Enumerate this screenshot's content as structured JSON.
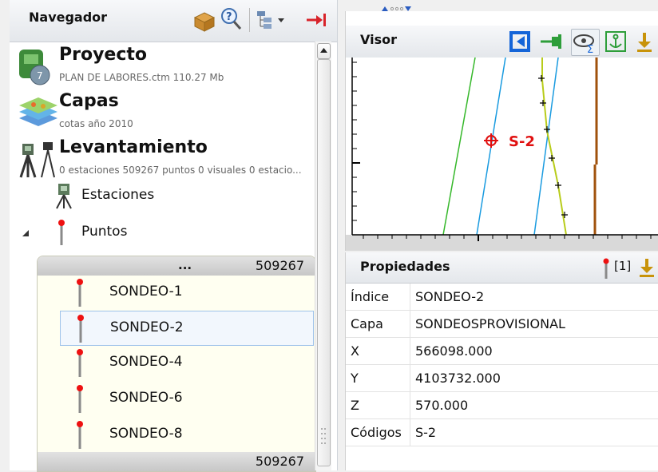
{
  "navigator": {
    "title": "Navegador",
    "groups": [
      {
        "title": "Proyecto",
        "subtitle": "PLAN DE LABORES.ctm 110.27 Mb",
        "icon": "project-icon"
      },
      {
        "title": "Capas",
        "subtitle": "cotas año 2010",
        "icon": "layers-icon"
      },
      {
        "title": "Levantamiento",
        "subtitle": "0 estaciones 509267 puntos 0 visuales 0 estacio...",
        "icon": "survey-icon"
      }
    ],
    "tree": [
      {
        "label": "Estaciones",
        "icon": "station-icon"
      },
      {
        "label": "Puntos",
        "icon": "point-marker-icon",
        "expanded": true
      }
    ],
    "points_list": {
      "header_dots": "...",
      "header_count": "509267",
      "footer_count": "509267",
      "items": [
        "SONDEO-1",
        "SONDEO-2",
        "SONDEO-4",
        "SONDEO-6",
        "SONDEO-8"
      ],
      "selected": "SONDEO-2"
    }
  },
  "visor": {
    "title": "Visor",
    "marker_label": "S-2"
  },
  "properties": {
    "title": "Propiedades",
    "selection_count": "[1]",
    "rows": [
      {
        "key": "Índice",
        "value": "SONDEO-2"
      },
      {
        "key": "Capa",
        "value": "SONDEOSPROVISIONAL"
      },
      {
        "key": "X",
        "value": "566098.000"
      },
      {
        "key": "Y",
        "value": "4103732.000"
      },
      {
        "key": "Z",
        "value": "570.000"
      },
      {
        "key": "Códigos",
        "value": "S-2"
      }
    ]
  },
  "colors": {
    "accent_blue": "#1565d8",
    "marker_red": "#e01010",
    "line_green": "#35b82a",
    "line_cyan": "#1a9be0",
    "line_yellow": "#b8cc1a",
    "line_brown": "#a0520c",
    "pin_green": "#2e9e3a",
    "arrow_gold": "#c8930a"
  }
}
